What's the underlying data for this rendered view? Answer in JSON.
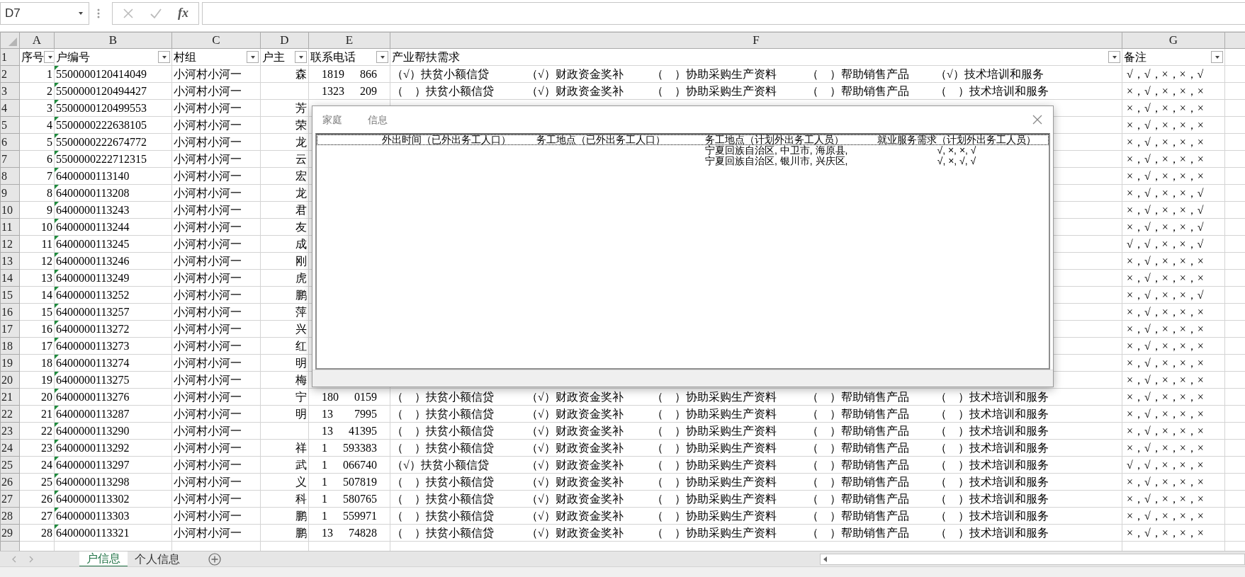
{
  "name_box": {
    "value": "D7"
  },
  "formula_bar": {
    "fx_label": "fx"
  },
  "column_headers": [
    "A",
    "B",
    "C",
    "D",
    "E",
    "F",
    "G"
  ],
  "header_row": {
    "row_number": "1",
    "cells": [
      "序号",
      "户编号",
      "村组",
      "户主",
      "联系电话",
      "产业帮扶需求",
      "备注"
    ]
  },
  "rows": [
    {
      "row_number": "2",
      "seq": "1",
      "code": "5500000120414049",
      "flag": true,
      "group": "小河村小河一",
      "head": "森",
      "phone": [
        "1819",
        "866"
      ],
      "support": [
        "（√）扶贫小额信贷",
        "（√）财政资金奖补",
        "（　）协助采购生产资料",
        "（　）帮助销售产品",
        "（√）技术培训和服务"
      ],
      "note": "√，√，×，×，√"
    },
    {
      "row_number": "3",
      "seq": "2",
      "code": "5500000120494427",
      "flag": true,
      "group": "小河村小河一",
      "phone": [
        "1323",
        "209"
      ],
      "support": [
        "（　）扶贫小额信贷",
        "（√）财政资金奖补",
        "（　）协助采购生产资料",
        "（　）帮助销售产品",
        "（　）技术培训和服务"
      ],
      "note": "×，√，×，×，×"
    },
    {
      "row_number": "4",
      "seq": "3",
      "code": "5500000120499553",
      "flag": true,
      "group": "小河村小河一",
      "head": "芳",
      "note": "×，√，×，×，×"
    },
    {
      "row_number": "5",
      "seq": "4",
      "code": "5500000222638105",
      "flag": true,
      "group": "小河村小河一",
      "head": "荣",
      "note": "×，√，×，×，×"
    },
    {
      "row_number": "6",
      "seq": "5",
      "code": "5500000222674772",
      "flag": true,
      "group": "小河村小河一",
      "head": "龙",
      "note": "×，√，×，×，×"
    },
    {
      "row_number": "7",
      "seq": "6",
      "code": "5500000222712315",
      "flag": true,
      "group": "小河村小河一",
      "head": "云",
      "note": "×，√，×，×，×"
    },
    {
      "row_number": "8",
      "seq": "7",
      "code": "6400000113140",
      "flag": true,
      "group": "小河村小河一",
      "head": "宏",
      "note": "×，√，×，×，×"
    },
    {
      "row_number": "9",
      "seq": "8",
      "code": "6400000113208",
      "flag": true,
      "group": "小河村小河一",
      "head": "龙",
      "note": "×，√，×，×，√"
    },
    {
      "row_number": "10",
      "seq": "9",
      "code": "6400000113243",
      "flag": true,
      "group": "小河村小河一",
      "head": "君",
      "note": "×，√，×，×，√"
    },
    {
      "row_number": "11",
      "seq": "10",
      "code": "6400000113244",
      "flag": true,
      "group": "小河村小河一",
      "head": "友",
      "note": "×，√，×，×，√"
    },
    {
      "row_number": "12",
      "seq": "11",
      "code": "6400000113245",
      "flag": true,
      "group": "小河村小河一",
      "head": "成",
      "note": "√，√，×，×，√"
    },
    {
      "row_number": "13",
      "seq": "12",
      "code": "6400000113246",
      "flag": true,
      "group": "小河村小河一",
      "head": "刚",
      "note": "×，√，×，×，×"
    },
    {
      "row_number": "14",
      "seq": "13",
      "code": "6400000113249",
      "flag": true,
      "group": "小河村小河一",
      "head": "虎",
      "note": "×，√，×，×，×"
    },
    {
      "row_number": "15",
      "seq": "14",
      "code": "6400000113252",
      "flag": true,
      "group": "小河村小河一",
      "head": "鹏",
      "note": "×，√，×，×，√"
    },
    {
      "row_number": "16",
      "seq": "15",
      "code": "6400000113257",
      "flag": true,
      "group": "小河村小河一",
      "head": "萍",
      "note": "×，√，×，×，×"
    },
    {
      "row_number": "17",
      "seq": "16",
      "code": "6400000113272",
      "flag": true,
      "group": "小河村小河一",
      "head": "兴",
      "note": "×，√，×，×，×"
    },
    {
      "row_number": "18",
      "seq": "17",
      "code": "6400000113273",
      "flag": true,
      "group": "小河村小河一",
      "head": "红",
      "note": "×，√，×，×，×"
    },
    {
      "row_number": "19",
      "seq": "18",
      "code": "6400000113274",
      "flag": true,
      "group": "小河村小河一",
      "head": "明",
      "note": "×，√，×，×，×"
    },
    {
      "row_number": "20",
      "seq": "19",
      "code": "6400000113275",
      "flag": true,
      "group": "小河村小河一",
      "head": "梅",
      "note": "×，√，×，×，×"
    },
    {
      "row_number": "21",
      "seq": "20",
      "code": "6400000113276",
      "flag": true,
      "group": "小河村小河一",
      "head": "宁",
      "phone": [
        "180",
        "0159"
      ],
      "support": [
        "（　）扶贫小额信贷",
        "（√）财政资金奖补",
        "（　）协助采购生产资料",
        "（　）帮助销售产品",
        "（　）技术培训和服务"
      ],
      "note": "×，√，×，×，×"
    },
    {
      "row_number": "22",
      "seq": "21",
      "code": "6400000113287",
      "flag": true,
      "group": "小河村小河一",
      "head": "明",
      "phone": [
        "13",
        "7995"
      ],
      "support": [
        "（　）扶贫小额信贷",
        "（√）财政资金奖补",
        "（　）协助采购生产资料",
        "（　）帮助销售产品",
        "（　）技术培训和服务"
      ],
      "note": "×，√，×，×，×"
    },
    {
      "row_number": "23",
      "seq": "22",
      "code": "6400000113290",
      "flag": true,
      "group": "小河村小河一",
      "phone": [
        "13",
        "41395"
      ],
      "support": [
        "（　）扶贫小额信贷",
        "（√）财政资金奖补",
        "（　）协助采购生产资料",
        "（　）帮助销售产品",
        "（　）技术培训和服务"
      ],
      "note": "×，√，×，×，×"
    },
    {
      "row_number": "24",
      "seq": "23",
      "code": "6400000113292",
      "flag": true,
      "group": "小河村小河一",
      "head": "祥",
      "phone": [
        "1",
        "593383"
      ],
      "support": [
        "（　）扶贫小额信贷",
        "（√）财政资金奖补",
        "（　）协助采购生产资料",
        "（　）帮助销售产品",
        "（　）技术培训和服务"
      ],
      "note": "×，√，×，×，×"
    },
    {
      "row_number": "25",
      "seq": "24",
      "code": "6400000113297",
      "flag": true,
      "group": "小河村小河一",
      "head": "武",
      "phone": [
        "1",
        "066740"
      ],
      "support": [
        "（√）扶贫小额信贷",
        "（√）财政资金奖补",
        "（　）协助采购生产资料",
        "（　）帮助销售产品",
        "（　）技术培训和服务"
      ],
      "note": "√，√，×，×，×"
    },
    {
      "row_number": "26",
      "seq": "25",
      "code": "6400000113298",
      "flag": true,
      "group": "小河村小河一",
      "head": "义",
      "phone": [
        "1",
        "507819"
      ],
      "support": [
        "（　）扶贫小额信贷",
        "（√）财政资金奖补",
        "（　）协助采购生产资料",
        "（　）帮助销售产品",
        "（　）技术培训和服务"
      ],
      "note": "×，√，×，×，×"
    },
    {
      "row_number": "27",
      "seq": "26",
      "code": "6400000113302",
      "flag": true,
      "group": "小河村小河一",
      "head": "科",
      "phone": [
        "1",
        "580765"
      ],
      "support": [
        "（　）扶贫小额信贷",
        "（√）财政资金奖补",
        "（　）协助采购生产资料",
        "（　）帮助销售产品",
        "（　）技术培训和服务"
      ],
      "note": "×，√，×，×，×"
    },
    {
      "row_number": "28",
      "seq": "27",
      "code": "6400000113303",
      "flag": true,
      "group": "小河村小河一",
      "head": "鹏",
      "phone": [
        "1",
        "559971"
      ],
      "support": [
        "（　）扶贫小额信贷",
        "（√）财政资金奖补",
        "（　）协助采购生产资料",
        "（　）帮助销售产品",
        "（　）技术培训和服务"
      ],
      "note": "×，√，×，×，×"
    },
    {
      "row_number": "29",
      "seq": "28",
      "code": "6400000113321",
      "flag": true,
      "group": "小河村小河一",
      "head": "鹏",
      "phone": [
        "13",
        "74828"
      ],
      "support": [
        "（　）扶贫小额信贷",
        "（√）财政资金奖补",
        "（　）协助采购生产资料",
        "（　）帮助销售产品",
        "（　）技术培训和服务"
      ],
      "note": "×，√，×，×，×"
    }
  ],
  "dialog": {
    "title_parts": [
      "家庭",
      "信息"
    ],
    "columns": [
      "外出时间（已外出务工人口）",
      "务工地点（已外出务工人口）",
      "务工地点（计划外出务工人员）",
      "就业服务需求（计划外出务工人员）"
    ],
    "rows": [
      {
        "planned_location": "宁夏回族自治区, 中卫市, 海原县,",
        "service_needs": "√, ×, ×, √"
      },
      {
        "planned_location": "宁夏回族自治区, 银川市, 兴庆区,",
        "service_needs": "√, ×, √, √"
      }
    ]
  },
  "sheet_tabs": [
    {
      "label": "户信息",
      "selected": true
    },
    {
      "label": "个人信息",
      "selected": false
    }
  ]
}
